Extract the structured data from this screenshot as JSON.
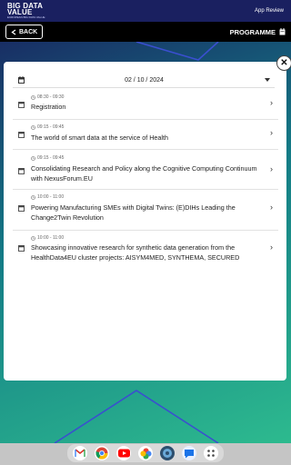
{
  "topbar": {
    "logo_line1": "BIG DATA",
    "logo_line2": "VALUE",
    "logo_line3": "EUROPEAN BIG DATA VALUE",
    "app_review": "App Review"
  },
  "navbar": {
    "back_label": "BACK",
    "title": "PROGRAMME"
  },
  "modal": {
    "date": "02 / 10 / 2024",
    "sessions": [
      {
        "time": "08:30 - 09:30",
        "title": "Registration"
      },
      {
        "time": "09:15 - 09:45",
        "title": "The world of smart data at the service of Health"
      },
      {
        "time": "09:15 - 09:45",
        "title": "Consolidating Research and Policy along the Cognitive Computing Continuum with NexusForum.EU"
      },
      {
        "time": "10:00 - 11:00",
        "title": "Powering Manufacturing SMEs with Digital Twins: (E)DIHs Leading the Change2Twin Revolution"
      },
      {
        "time": "10:00 - 11:00",
        "title": "Showcasing innovative research for synthetic data generation from the HealthData4EU cluster projects: AISYM4MED, SYNTHEMA, SECURED"
      }
    ]
  },
  "icons": {
    "calendar": "calendar-icon",
    "clock": "clock-icon",
    "chevron_right": "chevron-right-icon",
    "chevron_left": "chevron-left-icon",
    "dropdown": "caret-down-icon",
    "close": "close-icon"
  },
  "colors": {
    "topbar": "#1a2060",
    "navbar": "#000000",
    "bg_dark": "#1a1f5e",
    "bg_teal": "#137b86",
    "bg_green": "#2fbf8f",
    "accent_line": "#3a4fd0"
  },
  "dock_apps": [
    "gmail-icon",
    "chrome-icon",
    "youtube-icon",
    "photos-icon",
    "app-icon",
    "messages-icon",
    "apps-grid-icon"
  ]
}
